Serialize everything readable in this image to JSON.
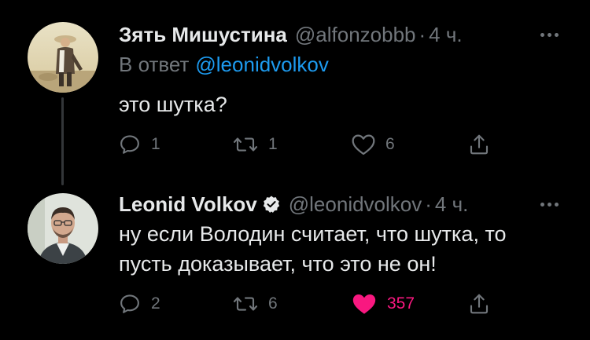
{
  "colors": {
    "background": "#000000",
    "text_primary": "#e7e9ea",
    "text_secondary": "#71767b",
    "link": "#1d9bf0",
    "like_active": "#f91880"
  },
  "tweets": [
    {
      "author_name": "Зять Мишустина",
      "author_handle": "@alfonzobbb",
      "separator": "·",
      "time": "4 ч.",
      "verified": false,
      "reply_to_prefix": "В ответ",
      "reply_to_handle": "@leonidvolkov",
      "text": "это шутка?",
      "replies": "1",
      "retweets": "1",
      "likes": "6",
      "liked": false,
      "icons": [
        "avatar",
        "more-icon",
        "reply-icon",
        "retweet-icon",
        "like-icon",
        "share-icon"
      ]
    },
    {
      "author_name": "Leonid Volkov",
      "author_handle": "@leonidvolkov",
      "separator": "·",
      "time": "4 ч.",
      "verified": true,
      "text": "ну если Володин считает, что шутка, то\nпусть доказывает, что это не он!",
      "replies": "2",
      "retweets": "6",
      "likes": "357",
      "liked": true,
      "icons": [
        "avatar",
        "verified-badge-icon",
        "more-icon",
        "reply-icon",
        "retweet-icon",
        "heart-filled-icon",
        "share-icon"
      ]
    }
  ]
}
